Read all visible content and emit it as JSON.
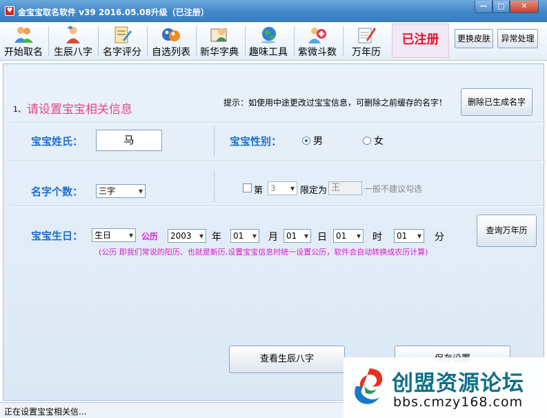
{
  "window": {
    "title": "金宝宝取名软件 v39   2016.05.08升级（已注册）",
    "app_icon": "heart-icon",
    "minimize": "—",
    "maximize": "□",
    "close": "✕"
  },
  "toolbar": {
    "items": [
      {
        "label": "开始取名",
        "icon": "users-icon"
      },
      {
        "label": "生辰八字",
        "icon": "person-icon"
      },
      {
        "label": "名字评分",
        "icon": "score-icon"
      },
      {
        "label": "自选列表",
        "icon": "list-icon"
      },
      {
        "label": "新华字典",
        "icon": "dictionary-icon"
      },
      {
        "label": "趣味工具",
        "icon": "globe-icon"
      },
      {
        "label": "紫微斗数",
        "icon": "medical-icon"
      },
      {
        "label": "万年历",
        "icon": "calendar-icon"
      }
    ],
    "registered": "已注册",
    "skin_button": "更换皮肤",
    "exception_button": "异常处理"
  },
  "main": {
    "step": "1、",
    "heading": "请设置宝宝相关信息",
    "hint": "提示：如使用中途更改过宝宝信息，可删除之前缓存的名字！",
    "delete_button": "删除已生成名字",
    "surname_label": "宝宝姓氏：",
    "surname_value": "马",
    "gender_label": "宝宝性别：",
    "gender_male": "男",
    "gender_female": "女",
    "gender_selected": "男",
    "count_label": "名字个数：",
    "count_value": "三字",
    "position_prefix": "第",
    "position_value": "3",
    "limit_label": "限定为",
    "limit_value": "王",
    "limit_note": "一般不建议勾选",
    "birth_label": "宝宝生日：",
    "birth_type": "生日",
    "calendar_type": "公历",
    "year_value": "2003",
    "year_unit": "年",
    "month_value": "01",
    "month_unit": "月",
    "day_value": "01",
    "day_unit": "日",
    "hour_value": "01",
    "hour_unit": "时",
    "minute_value": "01",
    "minute_unit": "分",
    "calendar_button": "查询万年历",
    "note": "(公历  即我们常说的阳历、也就是新历,设置宝宝信息时统一设置公历，软件会自动转换成农历计算)",
    "view_bazi_button": "查看生辰八字",
    "save_button": "保存设置"
  },
  "status": {
    "text": "正在设置宝宝相关信..."
  },
  "watermark": {
    "title": "创盟资源论坛",
    "url": "bbs.cmzy168.com"
  },
  "colors": {
    "title_bar": "#3f86c8",
    "label_blue": "#1d6fd0",
    "heading_pink": "#e8458b",
    "registered_red": "#e8122c",
    "calendar_magenta": "#d919c8"
  }
}
